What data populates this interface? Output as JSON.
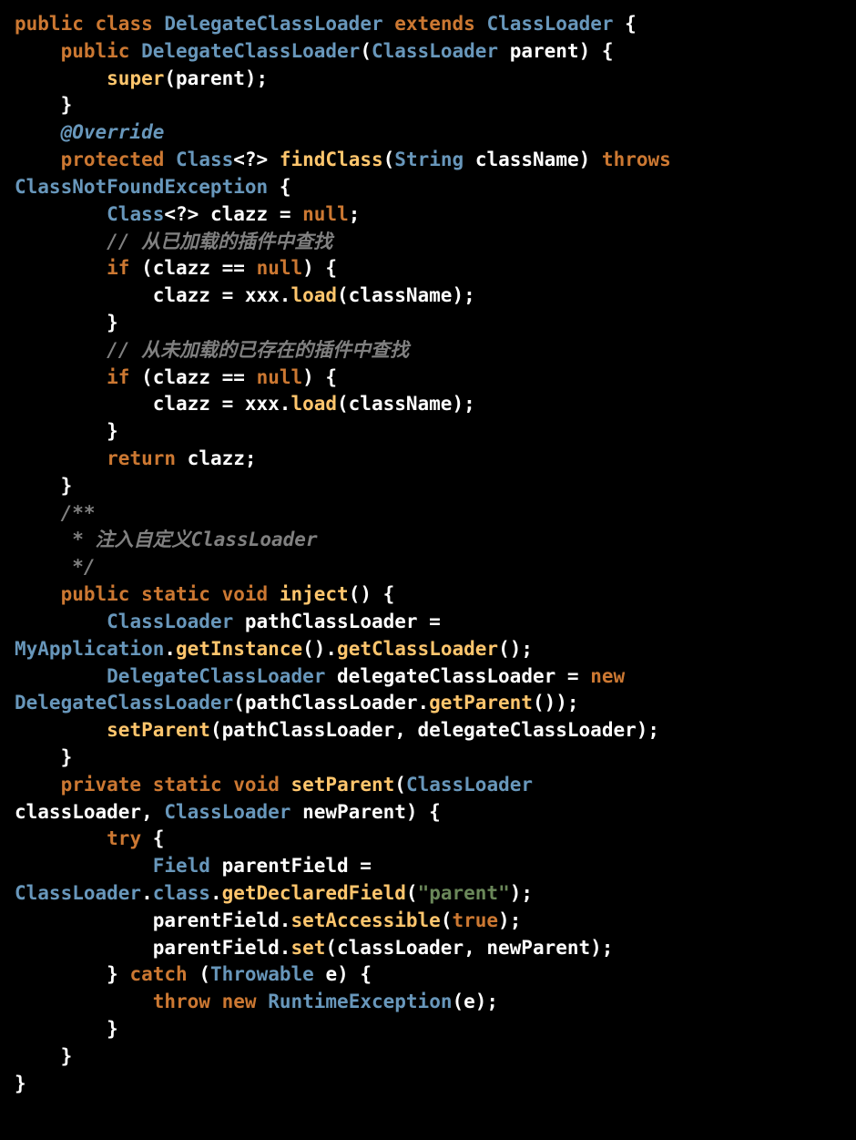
{
  "code": {
    "l1": {
      "kw1": "public",
      "kw2": "class",
      "t1": "DelegateClassLoader",
      "kw3": "extends",
      "t2": "ClassLoader",
      "b": "{"
    },
    "l2": {
      "kw1": "public",
      "t1": "DelegateClassLoader",
      "p1": "(",
      "t2": "ClassLoader",
      "id": "parent",
      "p2": ") {"
    },
    "l3": {
      "m": "super",
      "p": "(parent);"
    },
    "l4": {
      "b": "}"
    },
    "l5": {
      "ann": "@Override"
    },
    "l6": {
      "kw1": "protected",
      "t1": "Class",
      "g": "<?>",
      "m": "findClass",
      "p1": "(",
      "t2": "String",
      "id": "className",
      "p2": ")",
      "kw2": "throws"
    },
    "l7": {
      "t": "ClassNotFoundException",
      "b": "{"
    },
    "l8": {
      "t": "Class",
      "g": "<?>",
      "id": "clazz =",
      "lit": "null",
      "s": ";"
    },
    "l9": {
      "c": "// 从已加载的插件中查找"
    },
    "l10": {
      "kw": "if",
      "p1": "(clazz ==",
      "lit": "null",
      "p2": ") {"
    },
    "l11": {
      "id": "clazz = xxx.",
      "m": "load",
      "p": "(className);"
    },
    "l12": {
      "b": "}"
    },
    "l13": {
      "c": "// 从未加载的已存在的插件中查找"
    },
    "l14": {
      "kw": "if",
      "p1": "(clazz ==",
      "lit": "null",
      "p2": ") {"
    },
    "l15": {
      "id": "clazz = xxx.",
      "m": "load",
      "p": "(className);"
    },
    "l16": {
      "b": "}"
    },
    "l17": {
      "kw": "return",
      "id": "clazz;"
    },
    "l18": {
      "b": "}"
    },
    "l19": {
      "c": "/**"
    },
    "l20": {
      "c": " * 注入自定义ClassLoader"
    },
    "l21": {
      "c": " */"
    },
    "l22": {
      "kw1": "public",
      "kw2": "static",
      "kw3": "void",
      "m": "inject",
      "p": "() {"
    },
    "l23": {
      "t": "ClassLoader",
      "id": "pathClassLoader ="
    },
    "l24": {
      "t": "MyApplication",
      "d1": ".",
      "m1": "getInstance",
      "p1": "().",
      "m2": "getClassLoader",
      "p2": "();"
    },
    "l25": {
      "t": "DelegateClassLoader",
      "id": "delegateClassLoader =",
      "kw": "new"
    },
    "l26": {
      "t": "DelegateClassLoader",
      "p1": "(pathClassLoader.",
      "m": "getParent",
      "p2": "());"
    },
    "l27": {
      "m": "setParent",
      "p": "(pathClassLoader, delegateClassLoader);"
    },
    "l28": {
      "b": "}"
    },
    "l29": {
      "kw1": "private",
      "kw2": "static",
      "kw3": "void",
      "m": "setParent",
      "p1": "(",
      "t": "ClassLoader"
    },
    "l30": {
      "id1": "classLoader,",
      "t": "ClassLoader",
      "id2": "newParent) {"
    },
    "l31": {
      "kw": "try",
      "b": "{"
    },
    "l32": {
      "t": "Field",
      "id": "parentField ="
    },
    "l33": {
      "t": "ClassLoader",
      "d": ".",
      "f": "class",
      "d2": ".",
      "m": "getDeclaredField",
      "p1": "(",
      "s": "\"parent\"",
      "p2": ");"
    },
    "l34": {
      "id": "parentField.",
      "m": "setAccessible",
      "p1": "(",
      "lit": "true",
      "p2": ");"
    },
    "l35": {
      "id": "parentField.",
      "m": "set",
      "p": "(classLoader, newParent);"
    },
    "l36": {
      "b1": "}",
      "kw": "catch",
      "p1": "(",
      "t": "Throwable",
      "id": "e) {"
    },
    "l37": {
      "kw1": "throw",
      "kw2": "new",
      "t": "RuntimeException",
      "p": "(e);"
    },
    "l38": {
      "b": "}"
    },
    "l39": {
      "b": "}"
    },
    "l40": {
      "b": "}"
    }
  }
}
